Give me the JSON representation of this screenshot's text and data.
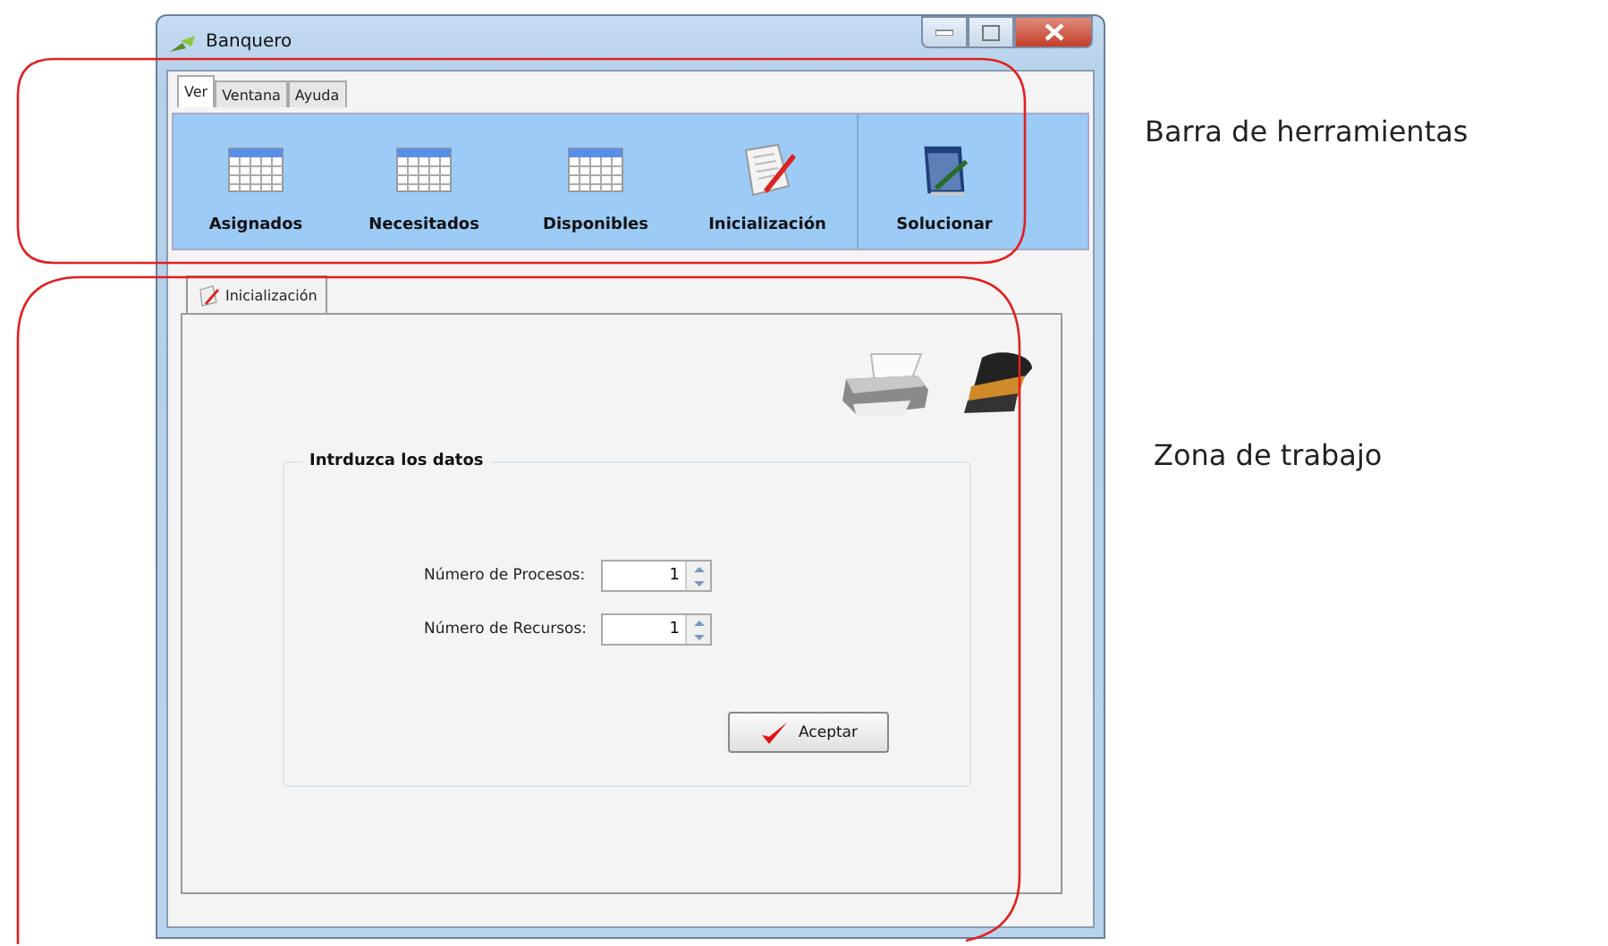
{
  "window": {
    "title": "Banquero"
  },
  "menu_tabs": [
    {
      "label": "Ver",
      "selected": true
    },
    {
      "label": "Ventana",
      "selected": false
    },
    {
      "label": "Ayuda",
      "selected": false
    }
  ],
  "toolbar": {
    "groups": [
      [
        {
          "label": "Asignados",
          "kind": "table"
        },
        {
          "label": "Necesitados",
          "kind": "table"
        },
        {
          "label": "Disponibles",
          "kind": "table"
        },
        {
          "label": "Inicialización",
          "kind": "document"
        }
      ],
      [
        {
          "label": "Solucionar",
          "kind": "notepad"
        }
      ]
    ]
  },
  "document_tabs": [
    {
      "label": "Inicialización",
      "selected": true
    }
  ],
  "panel": {
    "title": "Intrduzca los datos",
    "fields": [
      {
        "label": "Número de Procesos:",
        "value": "1"
      },
      {
        "label": "Número de Recursos:",
        "value": "1"
      }
    ],
    "button": "Aceptar"
  },
  "annotations": [
    {
      "label": "Barra de herramientas"
    },
    {
      "label": "Zona de trabajo"
    }
  ]
}
